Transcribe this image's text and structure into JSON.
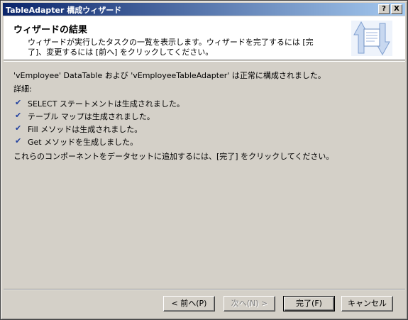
{
  "window": {
    "title": "TableAdapter 構成ウィザード",
    "help_label": "?",
    "close_label": "X"
  },
  "header": {
    "title": "ウィザードの結果",
    "description": "ウィザードが実行したタスクの一覧を表示します。ウィザードを完了するには [完了]、変更するには [前へ] をクリックしてください。"
  },
  "content": {
    "success_message": "'vEmployee' DataTable および 'vEmployeeTableAdapter' は正常に構成されました。",
    "details_label": "詳細:",
    "items": [
      {
        "text": "SELECT ステートメントは生成されました。"
      },
      {
        "text": "テーブル マップは生成されました。"
      },
      {
        "text": "Fill メソッドは生成されました。"
      },
      {
        "text": "Get メソッドを生成しました。"
      }
    ],
    "footer_message": "これらのコンポーネントをデータセットに追加するには、[完了] をクリックしてください。"
  },
  "buttons": {
    "prev": "< 前へ(P)",
    "next": "次へ(N) >",
    "finish": "完了(F)",
    "cancel": "キャンセル"
  },
  "colors": {
    "titlebar_start": "#0a246a",
    "titlebar_end": "#a6caf0",
    "check": "#1f3f9f"
  }
}
